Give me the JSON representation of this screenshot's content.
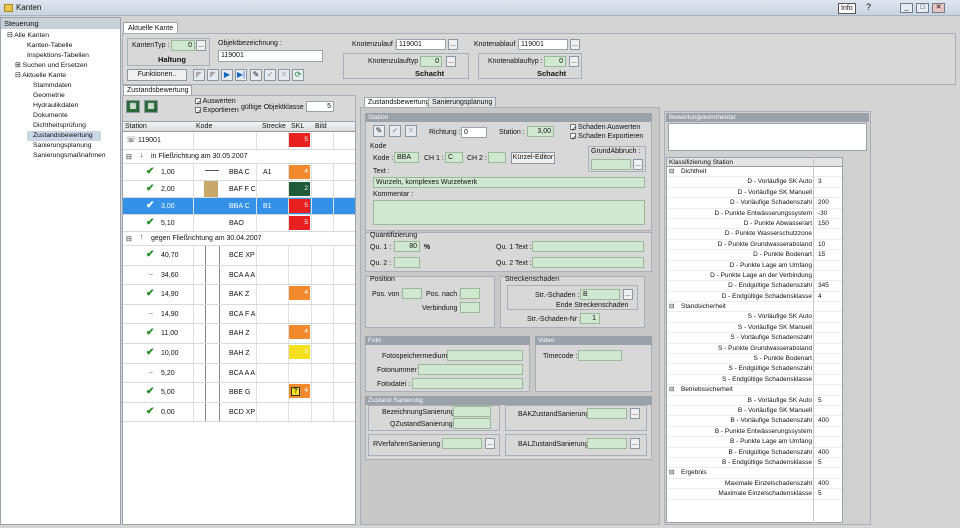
{
  "window": {
    "title": "Kanten",
    "info_label": "Info",
    "help_glyph": "?"
  },
  "nav": {
    "header": "Steuerung",
    "root": "Alle Kanten",
    "items": [
      "Kanten-Tabelle",
      "Inspektions-Tabellen",
      "Suchen und Ersetzen"
    ],
    "group2": "Aktuelle Kante",
    "sub": [
      "Stammdaten",
      "Geometrie",
      "Hydraulikdaten",
      "Dokumente",
      "Dichtheitsprüfung",
      "Zustandsbewertung",
      "Sanierungsplanung",
      "Sanierungsmaßnahmen"
    ]
  },
  "tab_main": "Aktuelle Kante",
  "header": {
    "kantentyp_label": "KantenTyp :",
    "kantentyp_value": "0",
    "haltung": "Haltung",
    "objekt_label": "Objektbezeichnung :",
    "objekt_value": "119001",
    "knotenzulauf_label": "Knotenzulauf :",
    "knotenzulauf_value": "119001",
    "knotenablauf_label": "Knotenablauf :",
    "knotenablauf_value": "119001",
    "kzt_label": "Knotenzulauftyp :",
    "kzt_value": "0",
    "kat_label": "Knotenablauftyp :",
    "kat_value": "0",
    "schacht1": "Schacht",
    "schacht2": "Schacht",
    "funktionen": "Funktionen.."
  },
  "subtab": "Zustandsbewertung",
  "left_tool": {
    "auswerten": "Auswerten",
    "exportieren": "Exportieren",
    "gk_label": "gültige Objektklasse :",
    "gk_value": "5"
  },
  "grid": {
    "cols": [
      "Station",
      "Kode",
      "Strecke",
      "SKL",
      "Bild"
    ],
    "top": {
      "station": "119001",
      "skl": "5"
    },
    "group1": "in Fließrichtung am 30.05.2007",
    "rows1": [
      {
        "station": "1,00",
        "kode": "BBA C",
        "strecke": "A1",
        "skl": "4",
        "color": "#f08a2c"
      },
      {
        "station": "2,00",
        "kode": "BAF F C",
        "strecke": "",
        "skl": "2",
        "color": "#1f5a3a"
      },
      {
        "station": "3,00",
        "kode": "BBA C",
        "strecke": "B1",
        "skl": "5",
        "color": "#e82020"
      },
      {
        "station": "5,10",
        "kode": "BAO",
        "strecke": "",
        "skl": "5",
        "color": "#e82020"
      }
    ],
    "group2": "gegen Fließrichtung am 30.04.2007",
    "rows2": [
      {
        "station": "40,70",
        "kode": "BCE XP",
        "skl": "",
        "check": true
      },
      {
        "station": "34,60",
        "kode": "BCA A A",
        "skl": "",
        "check": false
      },
      {
        "station": "14,90",
        "kode": "BAK Z",
        "skl": "4",
        "check": true,
        "color": "#f08a2c"
      },
      {
        "station": "14,90",
        "kode": "BCA F A",
        "skl": "",
        "check": false
      },
      {
        "station": "11,00",
        "kode": "BAH Z",
        "skl": "4",
        "check": true,
        "color": "#f08a2c"
      },
      {
        "station": "10,00",
        "kode": "BAH Z",
        "skl": "3",
        "check": true,
        "color": "#f5e020"
      },
      {
        "station": "5,20",
        "kode": "BCA A A",
        "skl": "",
        "check": false
      },
      {
        "station": "5,00",
        "kode": "BBE G",
        "skl": "4",
        "check": true,
        "color": "#f08a2c"
      },
      {
        "station": "0,00",
        "kode": "BCD XP",
        "skl": "",
        "check": true
      }
    ]
  },
  "tabs2": [
    "Zustandsbewertung",
    "Sanierungsplanung"
  ],
  "station": {
    "head": "Station",
    "richtung_label": "Richtung :",
    "richtung_value": "0",
    "station_label": "Station :",
    "station_value": "3,00",
    "sch_ausw": "Schaden Auswerten",
    "sch_exp": "Schaden Exportieren",
    "kode_head": "Kode",
    "kode_label": "Kode :",
    "kode_value": "BBA",
    "ch1_label": "CH 1 :",
    "ch1_value": "C",
    "ch2_label": "CH 2 :",
    "kuerzel": "Kürzel-Editor",
    "grundabbruch": "GrundAbbruch :",
    "text_label": "Text :",
    "text_value": "Wurzeln, komplexes Wurzelwerk",
    "kommentar_label": "Kommentar :"
  },
  "quant": {
    "head": "Quantifizierung",
    "qu1_label": "Qu. 1 :",
    "qu1_value": "80",
    "pct": "%",
    "qu2_label": "Qu. 2 :",
    "qu1t": "Qu. 1 Text :",
    "qu2t": "Qu. 2 Text :"
  },
  "position": {
    "head": "Position",
    "von": "Pos. von :",
    "nach": "Pos. nach :",
    "verb": "Verbindung :"
  },
  "strecke": {
    "head": "Streckenschaden",
    "label": "Str.-Schaden :",
    "value": "B",
    "ende": "Ende Streckenschaden",
    "nr_label": "Str.-Schaden-Nr :",
    "nr_value": "1"
  },
  "foto": {
    "head": "Foto",
    "medium": "Fotospeichermedium :",
    "nummer": "Fotonummer :",
    "datei": "Fotodatei :"
  },
  "video": {
    "head": "Video",
    "timecode": "Timecode :"
  },
  "zs": {
    "head": "Zustand Sanierung",
    "bez": "BezeichnungSanierung :",
    "qz": "QZustandSanierung :",
    "bak": "BAKZustandSanierung :",
    "rv": "RVerfahrenSanierung :",
    "bal": "BALZustandSanierung :"
  },
  "bewertung": {
    "head": "Bewertungskommentar"
  },
  "klass": {
    "head": "Klassifizierung Station",
    "rows": [
      {
        "t": "g",
        "l": "Dichtheit"
      },
      {
        "t": "r",
        "l": "D - Vorläufige SK Auto",
        "v": "3"
      },
      {
        "t": "r",
        "l": "D - Vorläufige SK Manuell",
        "v": ""
      },
      {
        "t": "r",
        "l": "D - Vorläufige Schadenszahl",
        "v": "200"
      },
      {
        "t": "r",
        "l": "D - Punkte Entwässerungssystem",
        "v": "-30"
      },
      {
        "t": "r",
        "l": "D - Punkte Abwasserart",
        "v": "150"
      },
      {
        "t": "r",
        "l": "D - Punkte Wasserschutzzone",
        "v": ""
      },
      {
        "t": "r",
        "l": "D - Punkte Grundwasserabstand",
        "v": "10"
      },
      {
        "t": "r",
        "l": "D - Punkte Bodenart",
        "v": "15"
      },
      {
        "t": "r",
        "l": "D - Punkte Lage am Umfang",
        "v": ""
      },
      {
        "t": "r",
        "l": "D - Punkte Lage an der Verbindung",
        "v": ""
      },
      {
        "t": "r",
        "l": "D - Endgültige Schadenszahl",
        "v": "345"
      },
      {
        "t": "r",
        "l": "D - Endgültige Schadensklasse",
        "v": "4"
      },
      {
        "t": "g",
        "l": "Standsicherheit"
      },
      {
        "t": "r",
        "l": "S - Vorläufige SK Auto",
        "v": ""
      },
      {
        "t": "r",
        "l": "S - Vorläufige SK Manuell",
        "v": ""
      },
      {
        "t": "r",
        "l": "S - Vorläufige Schadenszahl",
        "v": ""
      },
      {
        "t": "r",
        "l": "S - Punkte Grundwasserabstand",
        "v": ""
      },
      {
        "t": "r",
        "l": "S - Punkte Bodenart",
        "v": ""
      },
      {
        "t": "r",
        "l": "S - Endgültige Schadenszahl",
        "v": ""
      },
      {
        "t": "r",
        "l": "S - Endgültige Schadensklasse",
        "v": ""
      },
      {
        "t": "g",
        "l": "Betriebssicherheit"
      },
      {
        "t": "r",
        "l": "B - Vorläufige SK Auto",
        "v": "5"
      },
      {
        "t": "r",
        "l": "B - Vorläufige SK Manuell",
        "v": ""
      },
      {
        "t": "r",
        "l": "B - Vorläufige Schadenszahl",
        "v": "400"
      },
      {
        "t": "r",
        "l": "B - Punkte Entwässerungssystem",
        "v": ""
      },
      {
        "t": "r",
        "l": "B - Punkte Lage am Umfang",
        "v": ""
      },
      {
        "t": "r",
        "l": "B - Endgültige Schadenszahl",
        "v": "400"
      },
      {
        "t": "r",
        "l": "B - Endgültige Schadensklasse",
        "v": "5"
      },
      {
        "t": "g",
        "l": "Ergebnis"
      },
      {
        "t": "r",
        "l": "Maximale Einzelschadenszahl",
        "v": "400"
      },
      {
        "t": "r",
        "l": "Maximale Einzelschadensklasse",
        "v": "5"
      }
    ]
  }
}
